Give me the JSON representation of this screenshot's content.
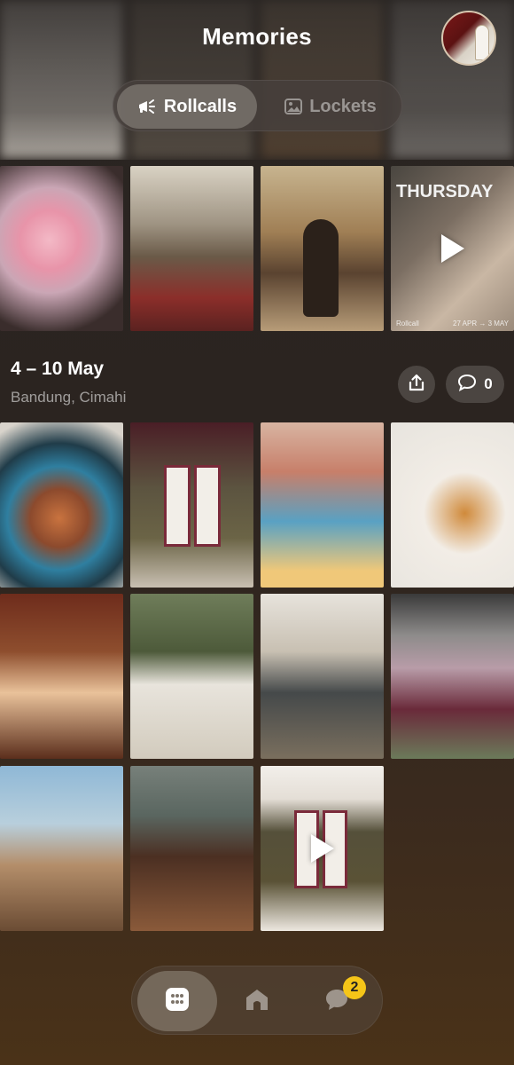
{
  "header": {
    "title": "Memories"
  },
  "segmented": {
    "rollcalls_label": "Rollcalls",
    "lockets_label": "Lockets",
    "active": "rollcalls"
  },
  "top_row": {
    "video_overlay_text": "THURSDAY",
    "rollcall_tag": "Rollcall",
    "date_tag": "27 APR → 3 MAY"
  },
  "section": {
    "title": "4 – 10 May",
    "location": "Bandung, Cimahi",
    "comment_count": "0"
  },
  "tabbar": {
    "chat_badge": "2",
    "active": "calendar"
  },
  "colors": {
    "accent_badge": "#f5c518",
    "background_dark": "#2a2522",
    "background_warm": "#4a3218"
  },
  "icons": {
    "rollcalls": "megaphone-icon",
    "lockets": "image-icon",
    "share": "share-icon",
    "comment": "comment-icon",
    "calendar": "calendar-icon",
    "home": "home-icon",
    "chat": "chat-bubble-icon",
    "play": "play-icon"
  }
}
